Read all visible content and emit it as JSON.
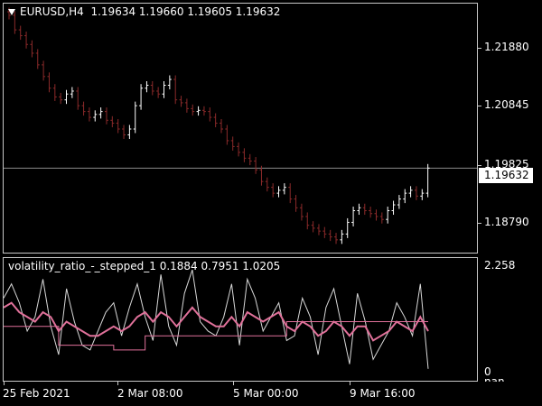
{
  "chart_header": {
    "symbol_timeframe": "EURUSD,H4",
    "ohlc": "1.19634 1.19660 1.19605 1.19632"
  },
  "indicator_header": {
    "name": "volatility_ratio_-_stepped_1",
    "values": "0.1884 0.7951 1.0205"
  },
  "price_axis": {
    "labels": [
      "1.21880",
      "1.20845",
      "1.19825",
      "1.18790"
    ],
    "current_price": "1.19632"
  },
  "indicator_axis": {
    "labels": [
      "2.258",
      "0",
      "nan"
    ]
  },
  "time_axis": {
    "labels": [
      "25 Feb 2021",
      "2 Mar 08:00",
      "5 Mar 00:00",
      "9 Mar 16:00"
    ]
  },
  "colors": {
    "background": "#000000",
    "bear_candle": "#8b2a2a",
    "bull_candle": "#ffffff",
    "current_price_line": "#8a8a8a",
    "indicator_pink": "#e0719a",
    "indicator_white": "#d8d8d8",
    "frame": "#c8c8c8"
  },
  "chart_data": [
    {
      "type": "candlestick",
      "symbol": "EURUSD",
      "timeframe": "H4",
      "ylim": [
        1.1815,
        1.2245
      ],
      "closes": [
        1.2225,
        1.22,
        1.219,
        1.2175,
        1.216,
        1.214,
        1.212,
        1.21,
        1.2085,
        1.208,
        1.209,
        1.2095,
        1.207,
        1.206,
        1.205,
        1.2055,
        1.206,
        1.2045,
        1.204,
        1.203,
        1.202,
        1.203,
        1.207,
        1.21,
        1.2105,
        1.2095,
        1.209,
        1.2105,
        1.2115,
        1.208,
        1.2075,
        1.2065,
        1.206,
        1.2062,
        1.206,
        1.205,
        1.204,
        1.203,
        1.201,
        1.2,
        1.199,
        1.198,
        1.1975,
        1.196,
        1.194,
        1.193,
        1.192,
        1.1925,
        1.193,
        1.191,
        1.1895,
        1.188,
        1.1865,
        1.186,
        1.1855,
        1.185,
        1.1845,
        1.184,
        1.185,
        1.187,
        1.189,
        1.1895,
        1.189,
        1.1885,
        1.188,
        1.1875,
        1.189,
        1.19,
        1.191,
        1.192,
        1.1925,
        1.1915,
        1.192,
        1.1963
      ]
    },
    {
      "type": "line",
      "title": "volatility_ratio_-_stepped_1",
      "ylim": [
        0,
        2.258
      ],
      "series": [
        {
          "name": "fast",
          "values": [
            1.6,
            1.9,
            1.5,
            0.9,
            1.2,
            2.0,
            1.0,
            0.4,
            1.8,
            1.1,
            0.6,
            0.5,
            0.9,
            1.3,
            1.5,
            0.8,
            1.4,
            1.9,
            1.2,
            0.7,
            2.1,
            1.0,
            0.6,
            1.7,
            2.2,
            1.1,
            0.9,
            0.8,
            1.2,
            1.9,
            0.6,
            2.0,
            1.6,
            0.9,
            1.2,
            1.5,
            0.7,
            0.8,
            1.6,
            1.2,
            0.4,
            1.4,
            1.8,
            1.0,
            0.2,
            1.7,
            1.1,
            0.3,
            0.6,
            0.9,
            1.5,
            1.2,
            0.8,
            1.9,
            0.1
          ]
        },
        {
          "name": "smooth",
          "values": [
            1.4,
            1.5,
            1.3,
            1.2,
            1.1,
            1.3,
            1.2,
            0.9,
            1.1,
            1.0,
            0.9,
            0.8,
            0.8,
            0.9,
            1.0,
            0.9,
            1.0,
            1.2,
            1.3,
            1.1,
            1.3,
            1.2,
            1.0,
            1.2,
            1.4,
            1.2,
            1.1,
            1.0,
            1.0,
            1.2,
            1.0,
            1.3,
            1.2,
            1.1,
            1.2,
            1.3,
            1.0,
            0.9,
            1.1,
            1.0,
            0.8,
            0.9,
            1.1,
            1.0,
            0.8,
            1.0,
            1.0,
            0.7,
            0.8,
            0.9,
            1.1,
            1.0,
            0.9,
            1.2,
            0.9
          ]
        },
        {
          "name": "stepped",
          "values": [
            1.0,
            1.0,
            1.0,
            1.0,
            1.0,
            1.0,
            1.0,
            0.6,
            0.6,
            0.6,
            0.6,
            0.6,
            0.6,
            0.6,
            0.5,
            0.5,
            0.5,
            0.5,
            0.8,
            0.8,
            0.8,
            0.8,
            0.8,
            0.8,
            0.8,
            0.8,
            0.8,
            0.8,
            0.8,
            0.8,
            0.8,
            0.8,
            0.8,
            0.8,
            0.8,
            0.8,
            1.1,
            1.1,
            1.1,
            1.1,
            1.1,
            1.1,
            1.1,
            1.1,
            1.1,
            1.1,
            1.1,
            1.1,
            1.1,
            1.1,
            1.1,
            1.1,
            1.1,
            1.1,
            1.1
          ]
        }
      ]
    }
  ]
}
